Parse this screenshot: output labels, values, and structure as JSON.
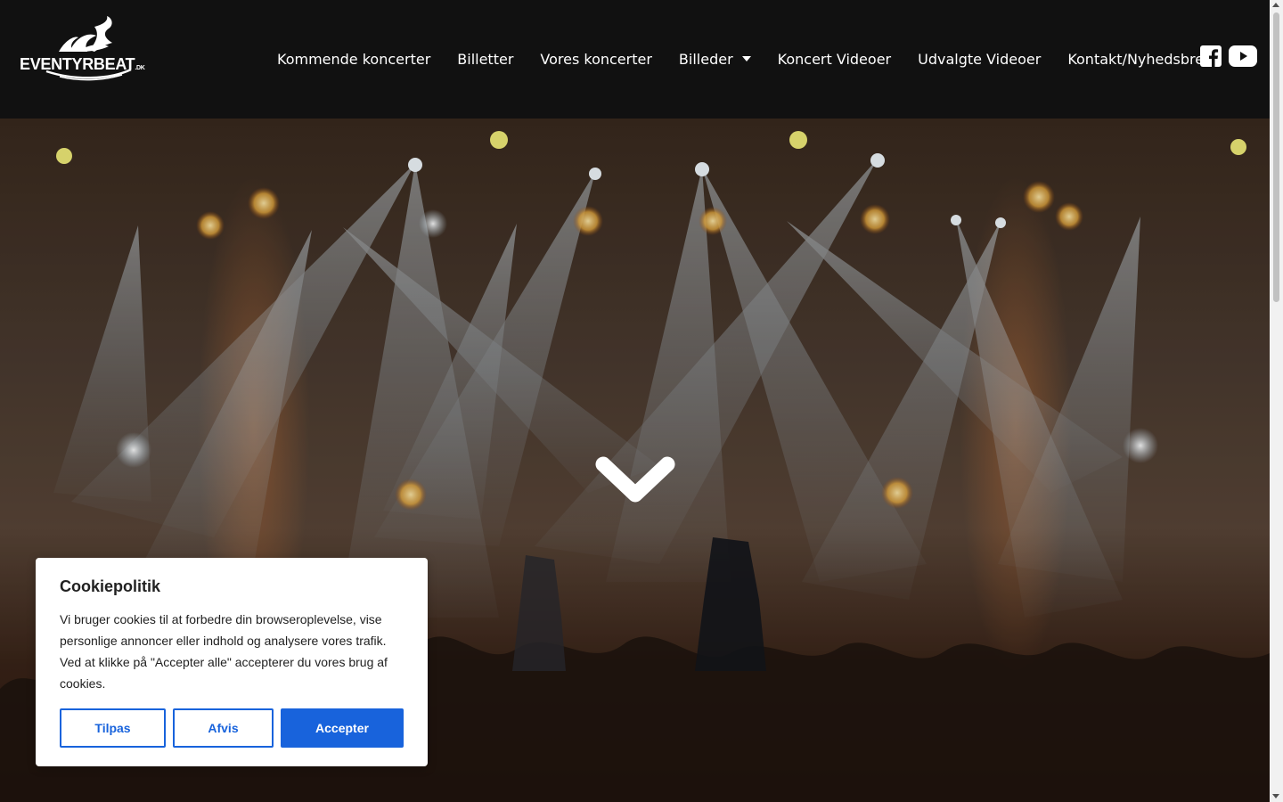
{
  "header": {
    "logo_text": "EVENTYRBEAT",
    "logo_suffix": ".DK",
    "nav": [
      {
        "label": "Kommende koncerter"
      },
      {
        "label": "Billetter"
      },
      {
        "label": "Vores koncerter"
      },
      {
        "label": "Billeder",
        "has_dropdown": true
      },
      {
        "label": "Koncert Videoer"
      },
      {
        "label": "Udvalgte Videoer"
      },
      {
        "label": "Kontakt/Nyhedsbrev"
      }
    ],
    "social_icons": [
      "facebook-icon",
      "youtube-icon"
    ]
  },
  "hero": {
    "scroll_icon": "chevron-down-icon"
  },
  "cookie_banner": {
    "title": "Cookiepolitik",
    "text": "Vi bruger cookies til at forbedre din browseroplevelse, vise personlige annoncer eller indhold og analysere vores trafik. Ved at klikke på \"Accepter alle\" accepterer du vores brug af cookies.",
    "customize_label": "Tilpas",
    "reject_label": "Afvis",
    "accept_label": "Accepter"
  },
  "colors": {
    "header_bg": "#111111",
    "accent_blue": "#1863dc",
    "text_dark": "#212121"
  }
}
